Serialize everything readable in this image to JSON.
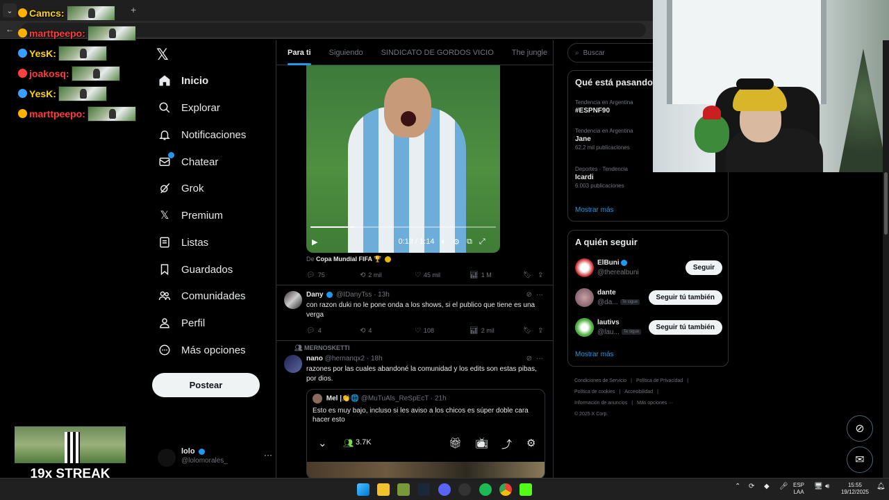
{
  "chat": {
    "lines": [
      {
        "user": "Camcs:",
        "color": "#ffd400"
      },
      {
        "user": "marttpeepo:",
        "color": "#ff3b3b"
      },
      {
        "user": "YesK:",
        "color": "#ffd400"
      },
      {
        "user": "joakosq:",
        "color": "#ff3b3b"
      },
      {
        "user": "YesK:",
        "color": "#ffd400"
      },
      {
        "user": "marttpeepo:",
        "color": "#ff3b3b"
      }
    ]
  },
  "nav": {
    "items": [
      {
        "label": "Inicio",
        "icon": "home-icon"
      },
      {
        "label": "Explorar",
        "icon": "search-icon"
      },
      {
        "label": "Notificaciones",
        "icon": "bell-icon"
      },
      {
        "label": "Chatear",
        "icon": "mail-icon"
      },
      {
        "label": "Grok",
        "icon": "grok-icon"
      },
      {
        "label": "Premium",
        "icon": "x-icon"
      },
      {
        "label": "Listas",
        "icon": "list-icon"
      },
      {
        "label": "Guardados",
        "icon": "bookmark-icon"
      },
      {
        "label": "Comunidades",
        "icon": "people-icon"
      },
      {
        "label": "Perfil",
        "icon": "person-icon"
      },
      {
        "label": "Más opciones",
        "icon": "more-circle-icon"
      }
    ],
    "post_label": "Postear",
    "profile_name": "lolo",
    "profile_handle": "@lolomorales_"
  },
  "tabs": [
    "Para ti",
    "Siguiendo",
    "SINDICATO DE GORDOS VICIO",
    "The jungle"
  ],
  "video_tweet": {
    "time": "0:18 / 1:14",
    "progress": 0.24,
    "source_prefix": "De",
    "source_name": "Copa Mundial FIFA 🏆",
    "replies": "75",
    "reposts": "2 mil",
    "likes": "45 mil",
    "views": "1 M"
  },
  "tweet1": {
    "name": "Dany",
    "handle": "@IDanyTss",
    "time": "· 13h",
    "text": "con razon duki no le pone onda a los shows, si el publico que tiene es una verga",
    "replies": "4",
    "reposts": "4",
    "likes": "108",
    "views": "2 mil"
  },
  "tweet2": {
    "repost_label": "MERNOSKETTI",
    "name": "nano",
    "handle": "@hernanqx2",
    "time": "· 18h",
    "text": "razones por las cuales abandoné la comunidad y los edits son estas pibas, por dios.",
    "quote": {
      "name": "Mel |👏🌐",
      "handle": "@MuTuAls_ReSpEcT",
      "time": "· 21h",
      "text": "Esto es muy bajo, incluso si les aviso a los chicos es súper doble cara hacer esto",
      "embed_count": "3.7K"
    }
  },
  "search": {
    "placeholder": "Buscar"
  },
  "trending": {
    "title": "Qué está pasando",
    "items": [
      {
        "context": "Tendencia en Argentina",
        "name": "#ESPNF90",
        "count": ""
      },
      {
        "context": "Tendencia en Argentina",
        "name": "Jane",
        "count": "62,2 mil publicaciones"
      },
      {
        "context": "Deportes · Tendencia",
        "name": "Icardi",
        "count": "6.003 publicaciones"
      }
    ],
    "show_more": "Mostrar más"
  },
  "follow": {
    "title": "A quién seguir",
    "items": [
      {
        "name": "ElBuni",
        "handle": "@therealbuni",
        "follows_you": "",
        "button": "Seguir"
      },
      {
        "name": "dante",
        "handle": "@da...",
        "follows_you": "Te sigue",
        "button": "Seguir tú también"
      },
      {
        "name": "lautivs",
        "handle": "@lau...",
        "follows_you": "Te sigue",
        "button": "Seguir tú también"
      }
    ],
    "show_more": "Mostrar más"
  },
  "footer": [
    "Condiciones de Servicio",
    "|",
    "Política de Privacidad",
    "|",
    "Política de cookies",
    "|",
    "Accesibilidad",
    "|",
    "Información de anuncios",
    "|",
    "Más opciones ···",
    "© 2025 X Corp."
  ],
  "streak": {
    "label": "19x STREAK"
  },
  "taskbar": {
    "lang_top": "ESP",
    "lang_bottom": "LAA",
    "time": "15:55",
    "date": "19/12/2025"
  },
  "colors": {
    "accent": "#1d9bf0",
    "background": "#000000",
    "border": "#2f3336",
    "muted": "#71767b"
  }
}
